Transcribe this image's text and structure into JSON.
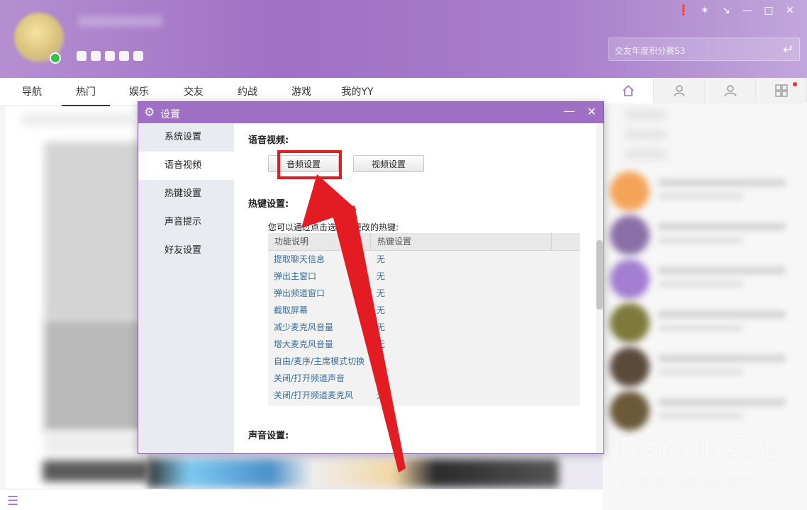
{
  "window_controls": [
    "❗",
    "✶",
    "↘",
    "—",
    "□",
    "✕"
  ],
  "search": {
    "placeholder": "交友年度积分赛S3"
  },
  "nav_tabs": [
    {
      "label": "导航"
    },
    {
      "label": "热门",
      "active": true
    },
    {
      "label": "娱乐"
    },
    {
      "label": "交友"
    },
    {
      "label": "约战"
    },
    {
      "label": "游戏"
    },
    {
      "label": "我的YY"
    }
  ],
  "right_nav": [
    "home-icon",
    "user-icon",
    "group-icon",
    "apps-icon"
  ],
  "dialog": {
    "title": "设置",
    "sidebar": [
      {
        "label": "系统设置"
      },
      {
        "label": "语音视频",
        "active": true
      },
      {
        "label": "热键设置"
      },
      {
        "label": "声音提示"
      },
      {
        "label": "好友设置"
      }
    ],
    "voice_video": {
      "heading": "语音视频:",
      "audio_button": "音频设置",
      "video_button": "视频设置"
    },
    "hotkey": {
      "heading": "热键设置:",
      "description": "您可以通过点击选择要更改的热键:",
      "columns": [
        "功能说明",
        "热键设置"
      ],
      "rows": [
        {
          "func": "提取聊天信息",
          "key": "无"
        },
        {
          "func": "弹出主窗口",
          "key": "无"
        },
        {
          "func": "弹出频道窗口",
          "key": "无"
        },
        {
          "func": "截取屏幕",
          "key": "无"
        },
        {
          "func": "减少麦克风音量",
          "key": "无"
        },
        {
          "func": "增大麦克风音量",
          "key": "无"
        },
        {
          "func": "自由/麦序/主席模式切换",
          "key": "无"
        },
        {
          "func": "关闭/打开频道声音",
          "key": "无"
        },
        {
          "func": "关闭/打开频道麦克风",
          "key": "无"
        }
      ]
    },
    "sound": {
      "heading": "声音设置:"
    }
  },
  "watermark": {
    "brand": "Bai du经验",
    "url": "jingyan.baidu.com"
  },
  "colors": {
    "accent": "#9f6fc3",
    "highlight": "#e31b23",
    "link": "#3a6d9a"
  }
}
